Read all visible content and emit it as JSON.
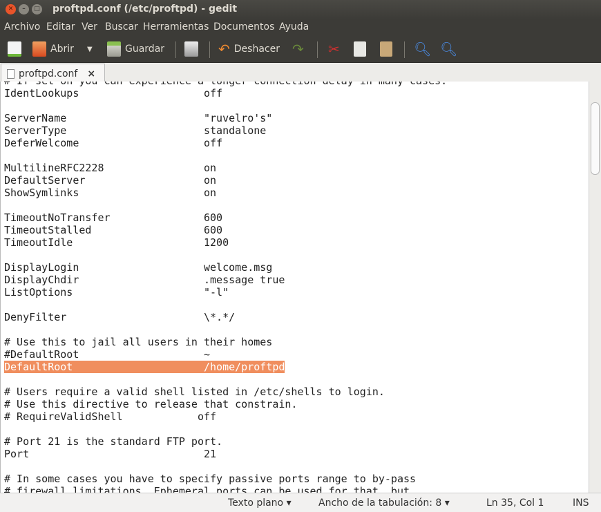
{
  "window": {
    "title": "proftpd.conf (/etc/proftpd) - gedit"
  },
  "menu": [
    "Archivo",
    "Editar",
    "Ver",
    "Buscar",
    "Herramientas",
    "Documentos",
    "Ayuda"
  ],
  "toolbar": {
    "open_label": "Abrir",
    "save_label": "Guardar",
    "undo_label": "Deshacer"
  },
  "tab": {
    "label": "proftpd.conf",
    "close": "×"
  },
  "editor": {
    "highlight_color": "#f08e5e",
    "lines": [
      "# If set on you can experience a longer connection delay in many cases.",
      "IdentLookups                    off",
      "",
      "ServerName                      \"ruvelro's\"",
      "ServerType                      standalone",
      "DeferWelcome                    off",
      "",
      "MultilineRFC2228                on",
      "DefaultServer                   on",
      "ShowSymlinks                    on",
      "",
      "TimeoutNoTransfer               600",
      "TimeoutStalled                  600",
      "TimeoutIdle                     1200",
      "",
      "DisplayLogin                    welcome.msg",
      "DisplayChdir                    .message true",
      "ListOptions                     \"-l\"",
      "",
      "DenyFilter                      \\*.*/",
      "",
      "# Use this to jail all users in their homes",
      "#DefaultRoot                    ~",
      "DefaultRoot                     /home/proftpd",
      "",
      "# Users require a valid shell listed in /etc/shells to login.",
      "# Use this directive to release that constrain.",
      "# RequireValidShell            off",
      "",
      "# Port 21 is the standard FTP port.",
      "Port                            21",
      "",
      "# In some cases you have to specify passive ports range to by-pass",
      "# firewall limitations. Ephemeral ports can be used for that, but"
    ],
    "highlighted_line": 23
  },
  "status": {
    "syntax": "Texto plano ▾",
    "tab_width": "Ancho de la tabulación: 8 ▾",
    "position": "Ln 35, Col 1",
    "mode": "INS"
  }
}
